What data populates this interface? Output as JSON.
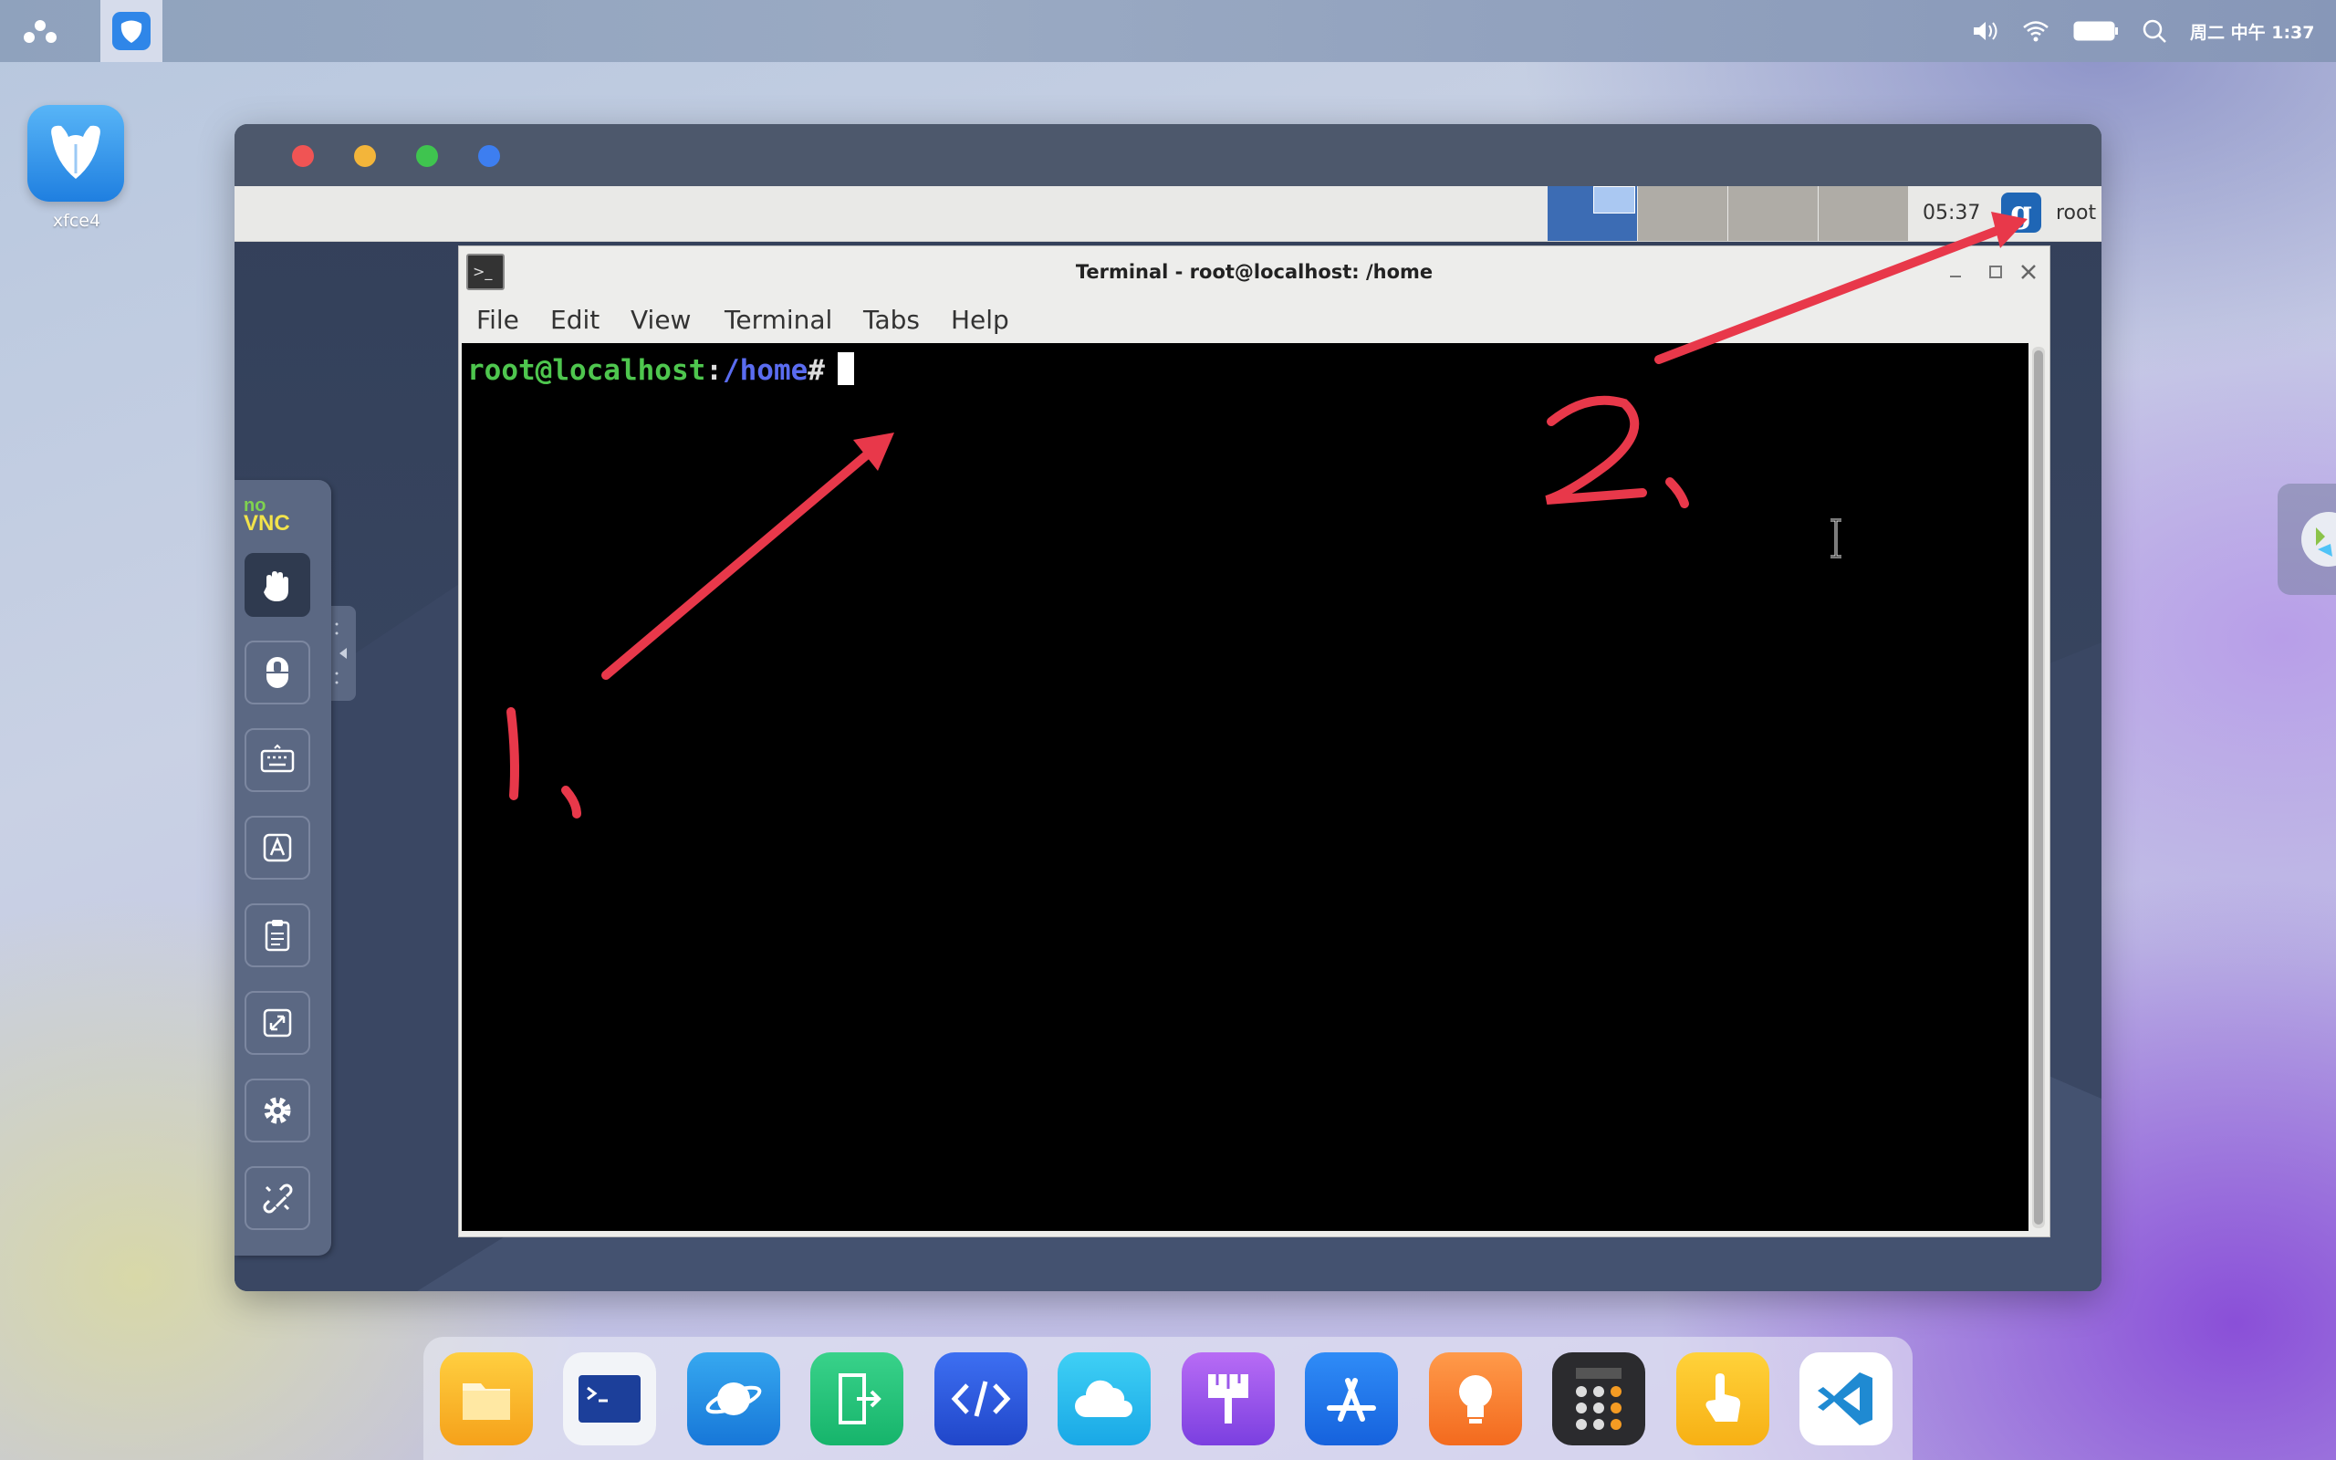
{
  "topbar": {
    "clock": "周二 中午 1:37"
  },
  "desktop": {
    "icon_label": "xfce4"
  },
  "xfce_panel": {
    "clock": "05:37",
    "user": "root",
    "g_label": "g"
  },
  "terminal": {
    "title": "Terminal - root@localhost: /home",
    "menu": [
      "File",
      "Edit",
      "View",
      "Terminal",
      "Tabs",
      "Help"
    ],
    "prompt_user": "root@localhost",
    "prompt_sep": ":",
    "prompt_path": "/home",
    "prompt_hash": "#"
  },
  "novnc": {
    "logo_top": "no",
    "logo_bottom": "VNC"
  },
  "annotations": {
    "label_1": "1.",
    "label_2": "2.",
    "arrow_color": "#e8384a"
  },
  "dock": {
    "apps": [
      "files",
      "terminal",
      "browser",
      "exit",
      "code-editor",
      "cloud",
      "paint",
      "app-store",
      "tips",
      "calculator",
      "touch",
      "vscode"
    ]
  }
}
